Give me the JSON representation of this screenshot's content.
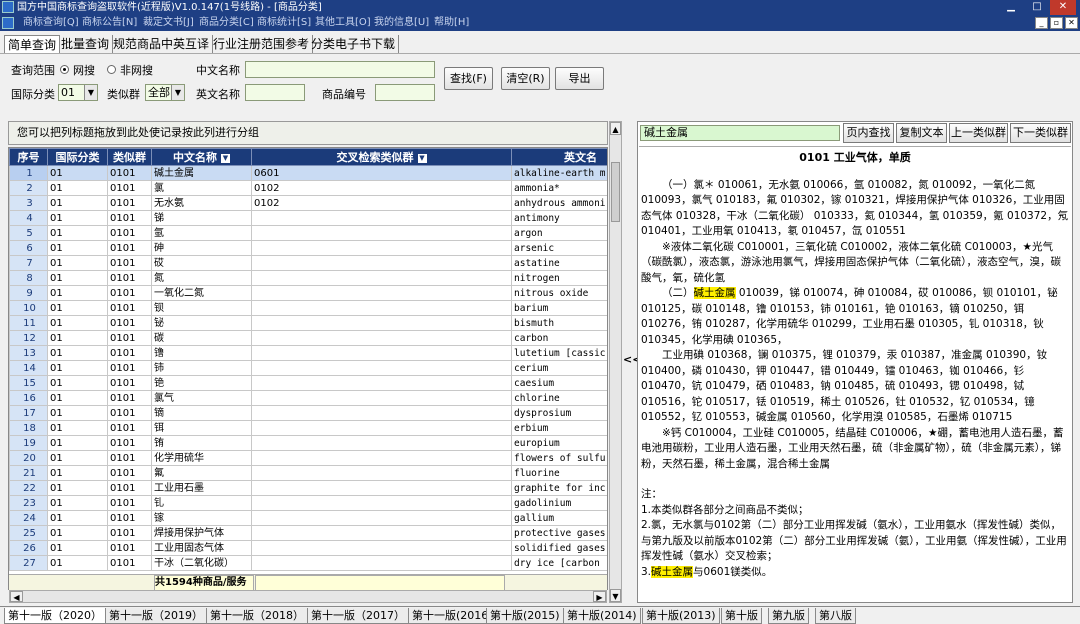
{
  "window": {
    "title": "国方中国商标查询盗取软件(近程版)V1.0.147(1号线路) - [商品分类]",
    "menu": [
      "商标查询[Q]",
      "商标公告[N]",
      "裁定文书[J]",
      "商品分类[C]",
      "商标统计[S]",
      "其他工具[O]",
      "我的信息[U]",
      "帮助[H]"
    ],
    "controls": [
      "▁",
      "□",
      "✕"
    ],
    "child_controls": [
      "_",
      "▫",
      "✕"
    ]
  },
  "feature_tabs": [
    "简单查询",
    "批量查询",
    "规范商品中英互译",
    "行业注册范围参考",
    "分类电子书下载"
  ],
  "search": {
    "scope_label": "查询范围",
    "scope_options": [
      "网搜",
      "非网搜"
    ],
    "class_label": "国际分类",
    "class_value": "01",
    "group_label": "类似群",
    "group_value": "全部",
    "cn_name_label": "中文名称",
    "en_name_label": "英文名称",
    "product_no_label": "商品编号",
    "find_button": "查找(F)",
    "clear_button": "清空(R)",
    "export_button": "导出"
  },
  "grid": {
    "group_hint": "您可以把列标题拖放到此处使记录按此列进行分组",
    "columns": [
      "序号",
      "国际分类",
      "类似群",
      "中文名称",
      "交叉检索类似群",
      "英文名"
    ],
    "rows": [
      [
        "1",
        "01",
        "0101",
        "碱土金属",
        "0601",
        "alkaline-earth m"
      ],
      [
        "2",
        "01",
        "0101",
        "氯",
        "0102",
        "ammonia*"
      ],
      [
        "3",
        "01",
        "0101",
        "无水氨",
        "0102",
        "anhydrous ammoni"
      ],
      [
        "4",
        "01",
        "0101",
        "锑",
        "",
        "antimony"
      ],
      [
        "5",
        "01",
        "0101",
        "氩",
        "",
        "argon"
      ],
      [
        "6",
        "01",
        "0101",
        "砷",
        "",
        "arsenic"
      ],
      [
        "7",
        "01",
        "0101",
        "砹",
        "",
        "astatine"
      ],
      [
        "8",
        "01",
        "0101",
        "氮",
        "",
        "nitrogen"
      ],
      [
        "9",
        "01",
        "0101",
        "一氧化二氮",
        "",
        "nitrous oxide"
      ],
      [
        "10",
        "01",
        "0101",
        "钡",
        "",
        "barium"
      ],
      [
        "11",
        "01",
        "0101",
        "铋",
        "",
        "bismuth"
      ],
      [
        "12",
        "01",
        "0101",
        "碳",
        "",
        "carbon"
      ],
      [
        "13",
        "01",
        "0101",
        "镥",
        "",
        "lutetium [cassic"
      ],
      [
        "14",
        "01",
        "0101",
        "铈",
        "",
        "cerium"
      ],
      [
        "15",
        "01",
        "0101",
        "铯",
        "",
        "caesium"
      ],
      [
        "16",
        "01",
        "0101",
        "氯气",
        "",
        "chlorine"
      ],
      [
        "17",
        "01",
        "0101",
        "镝",
        "",
        "dysprosium"
      ],
      [
        "18",
        "01",
        "0101",
        "铒",
        "",
        "erbium"
      ],
      [
        "19",
        "01",
        "0101",
        "铕",
        "",
        "europium"
      ],
      [
        "20",
        "01",
        "0101",
        "化学用硫华",
        "",
        "flowers of sulfu"
      ],
      [
        "21",
        "01",
        "0101",
        "氟",
        "",
        "fluorine"
      ],
      [
        "22",
        "01",
        "0101",
        "工业用石墨",
        "",
        "graphite for inc"
      ],
      [
        "23",
        "01",
        "0101",
        "钆",
        "",
        "gadolinium"
      ],
      [
        "24",
        "01",
        "0101",
        "镓",
        "",
        "gallium"
      ],
      [
        "25",
        "01",
        "0101",
        "焊接用保护气体",
        "",
        "protective gases"
      ],
      [
        "26",
        "01",
        "0101",
        "工业用固态气体",
        "",
        "solidified gases"
      ],
      [
        "27",
        "01",
        "0101",
        "干冰（二氧化碳）",
        "",
        "dry ice [carbon"
      ]
    ],
    "total": "共1594种商品/服务"
  },
  "splitter_label": "<<",
  "right_panel": {
    "search_value": "碱土金属",
    "buttons": [
      "页内查找",
      "复制文本",
      "上一类似群",
      "下一类似群"
    ],
    "doc_title": "0101  工业气体，单质",
    "para1": "（一）氯＊ 010061，无水氨 010066，氩 010082，氮 010092，一氧化二氮 010093，氯气 010183，氟 010302，镓 010321，焊接用保护气体 010326，工业用固态气体 010328，干冰（二氧化碳） 010333，氦 010344，氢 010359，氪 010372，氖 010401，工业用氧 010413，氡 010457，氙 010551",
    "para2": "※液体二氧化碳 C010001，三氧化硫 C010002，液体二氧化硫 C010003，★光气（碳酰氯），液态氯，游泳池用氯气，焊接用固态保护气体（二氧化硫），液态空气，溴，碳酸气，氧，硫化氢",
    "para3_hl": "碱土金属",
    "para3_rest": " 010039，锑 010074，砷 010084，砹 010086，钡 010101，铋 010125，碳 010148，镥 010153，铈 010161，铯 010163，镝 010250，铒 010276，铕 010287，化学用硫华 010299，工业用石墨 010305，钆 010318，钬 010345，化学用碘 010365，",
    "para4": "工业用碘 010368，镧 010375，锂 010379，汞 010387，准金属 010390，钕 010400，磷 010430，钾 010447，镨 010449，镭 010463，铷 010466，钐 010470，钪 010479，硒 010483，钠 010485，硫 010493，锶 010498，铽 010516，铊 010517，铥 010519，稀土 010526，钍 010532，钇 010534，镱 010552，钇 010553，碱金属 010560，化学用溴 010585，石墨烯 010715",
    "para5": "※钙 C010004，工业硅 C010005，结晶硅 C010006，★硼，蓄电池用人造石墨，蓄电池用碳粉，工业用人造石墨，工业用天然石墨，硫（非金属矿物），硫（非金属元素），锑粉，天然石墨，稀土金属，混合稀土金属",
    "note_head": "注：",
    "note1": "1.本类似群各部分之间商品不类似；",
    "note2": "2.氯，无水氯与0102第（二）部分工业用挥发碱（氨水），工业用氨水（挥发性碱）类似，与第九版及以前版本0102第（二）部分工业用挥发碱（氨），工业用氨（挥发性碱），工业用挥发性碱（氨水）交叉检索；",
    "note3_prefix": "3.",
    "note3_hl": "碱土金属",
    "note3_rest": "与0601镁类似。"
  },
  "edition_tabs": [
    "第十一版（2020）",
    "第十一版（2019）",
    "第十一版（2018）",
    "第十一版（2017）",
    "第十一版(2016)",
    "第十版(2015)",
    "第十版(2014)",
    "第十版(2013)",
    "第十版",
    "第九版",
    "第八版"
  ]
}
